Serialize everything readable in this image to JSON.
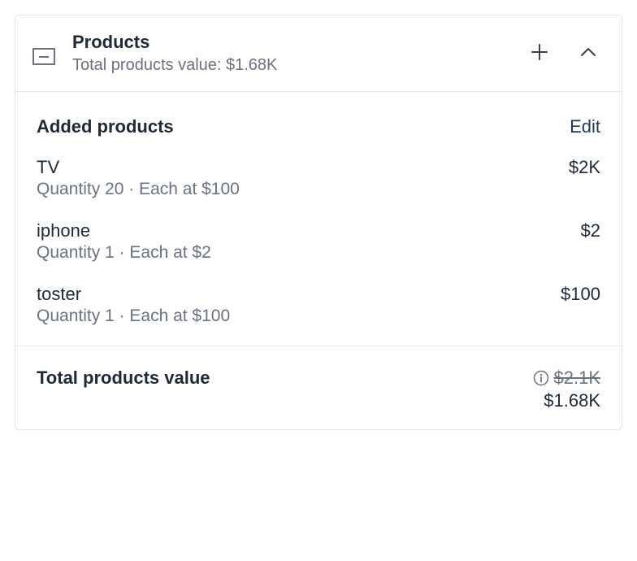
{
  "header": {
    "title": "Products",
    "subtitle": "Total products value: $1.68K"
  },
  "body": {
    "section_title": "Added products",
    "edit_label": "Edit",
    "products": [
      {
        "name": "TV",
        "meta": "Quantity 20 · Each at $100",
        "price": "$2K"
      },
      {
        "name": "iphone",
        "meta": "Quantity 1 · Each at $2",
        "price": "$2"
      },
      {
        "name": "toster",
        "meta": "Quantity 1 · Each at $100",
        "price": "$100"
      }
    ]
  },
  "footer": {
    "label": "Total products value",
    "old_value": "$2.1K",
    "new_value": "$1.68K"
  }
}
